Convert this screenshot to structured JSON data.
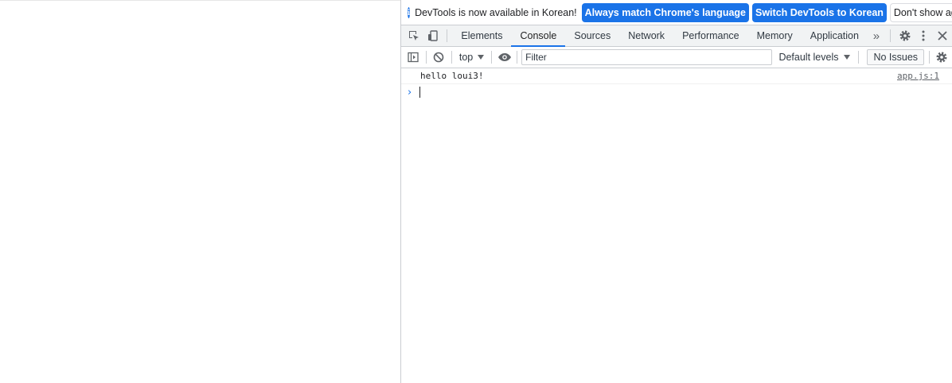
{
  "infobar": {
    "icon": "info-icon",
    "message": "DevTools is now available in Korean!",
    "primary_button": "Always match Chrome's language",
    "secondary_button": "Switch DevTools to Korean",
    "dismiss_button": "Don't show again",
    "accent": "#1a73e8"
  },
  "tabs": {
    "items": [
      "Elements",
      "Console",
      "Sources",
      "Network",
      "Performance",
      "Memory",
      "Application"
    ],
    "active": "Console",
    "icons": [
      "inspect-element-icon",
      "device-toolbar-icon",
      "more-tabs-icon",
      "settings-gear-icon",
      "kebab-menu-icon",
      "close-icon"
    ]
  },
  "console_toolbar": {
    "context": "top",
    "filter_placeholder": "Filter",
    "levels": "Default levels",
    "issues": "No Issues",
    "icons": [
      "sidebar-toggle-icon",
      "clear-console-icon",
      "live-expression-eye-icon",
      "console-settings-icon"
    ]
  },
  "console": {
    "messages": [
      {
        "text": "hello loui3!",
        "source": "app.js:1"
      }
    ],
    "prompt_icon": "prompt-chevron-icon"
  }
}
